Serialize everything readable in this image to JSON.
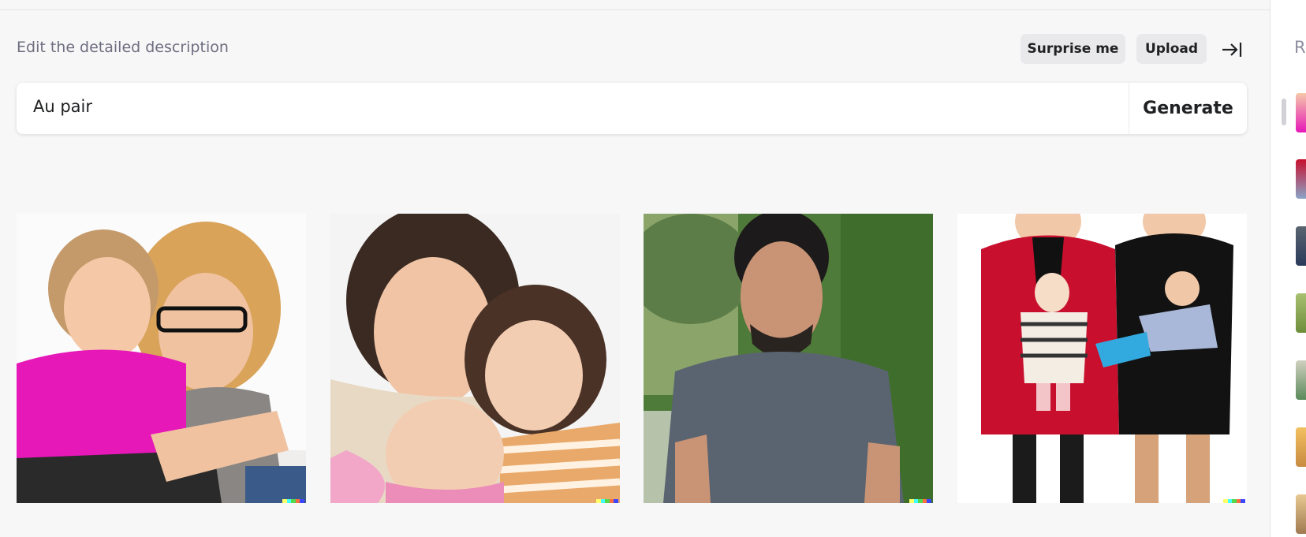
{
  "header": {
    "label": "Edit the detailed description",
    "surprise_label": "Surprise me",
    "upload_label": "Upload"
  },
  "prompt": {
    "value": "Au pair",
    "generate_label": "Generate"
  },
  "results": [
    {
      "subject": "woman-and-girl-photo"
    },
    {
      "subject": "woman-with-toddler-and-baby-photo"
    },
    {
      "subject": "man-outdoors-photo"
    },
    {
      "subject": "two-women-holding-dolls-photo"
    }
  ],
  "right_panel": {
    "initial": "R"
  },
  "colors": {
    "background": "#f7f7f8",
    "button": "#e9e9ec",
    "text": "#202123",
    "muted": "#6e6e80"
  }
}
